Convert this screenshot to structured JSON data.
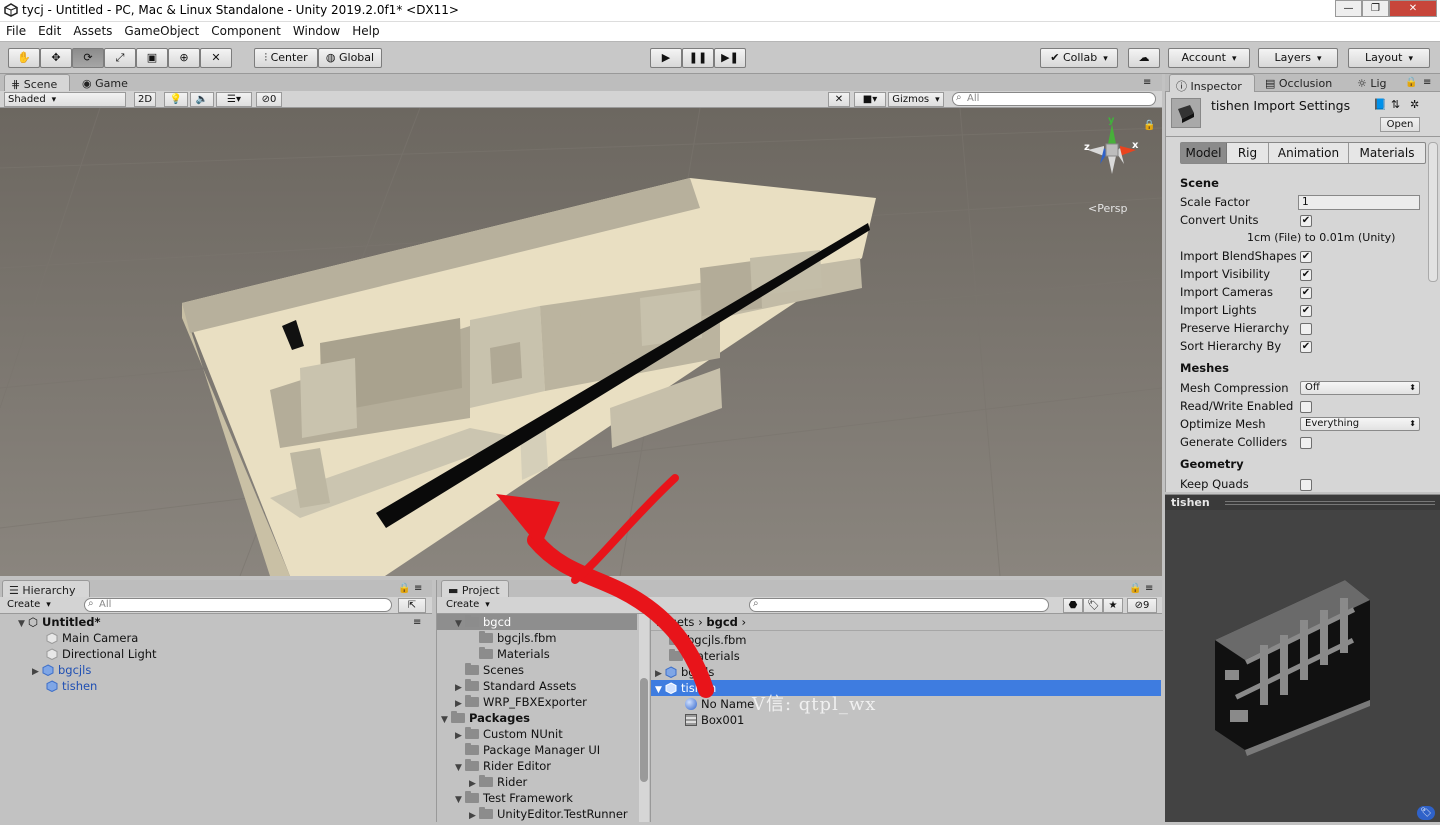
{
  "window": {
    "title": "tycj - Untitled - PC, Mac & Linux Standalone - Unity 2019.2.0f1* <DX11>",
    "controls": [
      "—",
      "❐",
      "✕"
    ]
  },
  "menu": [
    "File",
    "Edit",
    "Assets",
    "GameObject",
    "Component",
    "Window",
    "Help"
  ],
  "toolbar": {
    "pivot": "Center",
    "space": "Global",
    "collab": "Collab",
    "account": "Account",
    "layers": "Layers",
    "layout": "Layout"
  },
  "scene_panel": {
    "tabs": [
      "Scene",
      "Game"
    ],
    "shading": "Shaded",
    "mode_2d": "2D",
    "hidden_count": "0",
    "gizmos": "Gizmos",
    "search_placeholder": "All",
    "persp": "Persp",
    "gizmo_axes": [
      "y",
      "z",
      "x"
    ]
  },
  "inspector": {
    "tabs": [
      "Inspector",
      "Occlusion",
      "Lig"
    ],
    "title": "tishen Import Settings",
    "open": "Open",
    "subtabs": [
      "Model",
      "Rig",
      "Animation",
      "Materials"
    ],
    "sections": {
      "scene": "Scene",
      "meshes": "Meshes",
      "geometry": "Geometry"
    },
    "scale_factor_label": "Scale Factor",
    "scale_factor_value": "1",
    "convert_units_label": "Convert Units",
    "convert_units_note": "1cm (File) to 0.01m (Unity)",
    "toggles": [
      {
        "label": "Import BlendShapes",
        "checked": true
      },
      {
        "label": "Import Visibility",
        "checked": true
      },
      {
        "label": "Import Cameras",
        "checked": true
      },
      {
        "label": "Import Lights",
        "checked": true
      },
      {
        "label": "Preserve Hierarchy",
        "checked": false
      },
      {
        "label": "Sort Hierarchy By Na",
        "checked": true
      }
    ],
    "mesh_compression_label": "Mesh Compression",
    "mesh_compression_value": "Off",
    "rw_label": "Read/Write Enabled",
    "optimize_label": "Optimize Mesh",
    "optimize_value": "Everything",
    "colliders_label": "Generate Colliders",
    "keep_quads_label": "Keep Quads",
    "preview_title": "tishen"
  },
  "hierarchy": {
    "tab": "Hierarchy",
    "create": "Create",
    "search_placeholder": "All",
    "scene_name": "Untitled*",
    "items": [
      "Main Camera",
      "Directional Light",
      "bgcjls",
      "tishen"
    ]
  },
  "project": {
    "tab": "Project",
    "create": "Create",
    "hidden_count": "9",
    "tree": [
      {
        "label": "bgcd",
        "indent": 1,
        "arrow": "▼",
        "selected": true
      },
      {
        "label": "bgcjls.fbm",
        "indent": 2,
        "arrow": ""
      },
      {
        "label": "Materials",
        "indent": 2,
        "arrow": ""
      },
      {
        "label": "Scenes",
        "indent": 1,
        "arrow": ""
      },
      {
        "label": "Standard Assets",
        "indent": 1,
        "arrow": "▶"
      },
      {
        "label": "WRP_FBXExporter",
        "indent": 1,
        "arrow": "▶"
      },
      {
        "label": "Packages",
        "indent": 0,
        "arrow": "▼",
        "bold": true
      },
      {
        "label": "Custom NUnit",
        "indent": 1,
        "arrow": "▶"
      },
      {
        "label": "Package Manager UI",
        "indent": 1,
        "arrow": ""
      },
      {
        "label": "Rider Editor",
        "indent": 1,
        "arrow": "▼"
      },
      {
        "label": "Rider",
        "indent": 2,
        "arrow": "▶"
      },
      {
        "label": "Test Framework",
        "indent": 1,
        "arrow": "▼"
      },
      {
        "label": "UnityEditor.TestRunner",
        "indent": 2,
        "arrow": "▶"
      }
    ],
    "breadcrumb": [
      "Assets",
      "bgcd"
    ],
    "files": [
      {
        "label": "bgcjls.fbm",
        "type": "folder"
      },
      {
        "label": "Materials",
        "type": "folder"
      },
      {
        "label": "bgcjls",
        "type": "model"
      },
      {
        "label": "tishen",
        "type": "model",
        "selected": true
      },
      {
        "label": "No Name",
        "type": "sphere"
      },
      {
        "label": "Box001",
        "type": "mesh"
      }
    ]
  },
  "watermark": "V信: qtpl_wx",
  "colors": {
    "selection": "#3e7ce0",
    "annotation_arrow": "#e8141a",
    "scene_bg_top": "#6c6760",
    "scene_bg_bottom": "#8a857e",
    "preview_bg": "#434343"
  }
}
